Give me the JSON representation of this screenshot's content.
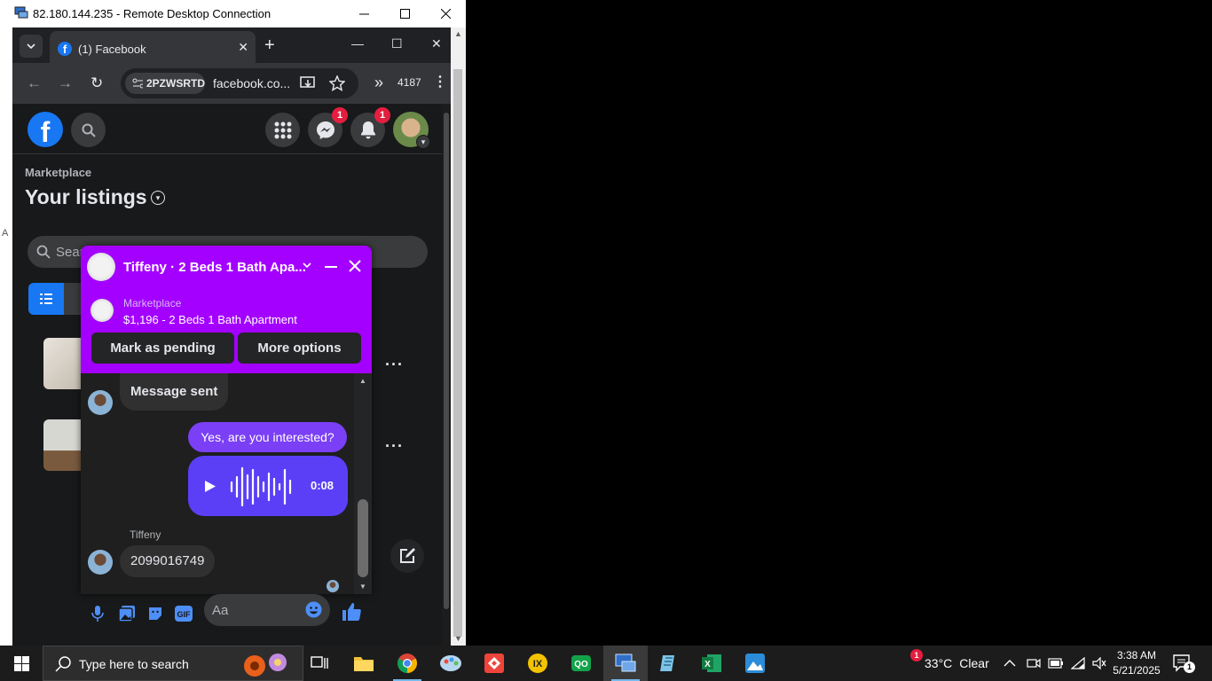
{
  "rdp": {
    "title": "82.180.144.235 - Remote Desktop Connection",
    "left_strip_text": "A"
  },
  "browser": {
    "tab_title": "(1) Facebook",
    "site_chip": "2PZWSRTD",
    "url": "facebook.co...",
    "ext_count": "4187"
  },
  "fb": {
    "logo": "f",
    "messenger_badge": "1",
    "notifications_badge": "1",
    "breadcrumb": "Marketplace",
    "page_title": "Your listings",
    "search_placeholder": "Sear"
  },
  "chat": {
    "title": "Tiffeny · 2 Beds 1 Bath Apa...",
    "context_label": "Marketplace",
    "context_title": "$1,196 - 2 Beds 1 Bath Apartment",
    "mark_pending": "Mark as pending",
    "more_options": "More options",
    "messages": [
      {
        "from": "them",
        "text": "Message sent"
      },
      {
        "from": "me",
        "text": "Yes, are you interested?"
      },
      {
        "from": "me",
        "type": "voice",
        "duration": "0:08"
      },
      {
        "from": "them",
        "sender": "Tiffeny",
        "text": "2099016749"
      }
    ],
    "composer_placeholder": "Aa"
  },
  "taskbar": {
    "search_placeholder": "Type here to search",
    "weather_badge": "1",
    "temperature": "33°C",
    "condition": "Clear",
    "time": "3:38 AM",
    "date": "5/21/2025",
    "notification_count": "1"
  },
  "colors": {
    "chat_header": "#a300ff",
    "fb_blue": "#1877f2",
    "out_bubble": "#7b3ff6"
  }
}
